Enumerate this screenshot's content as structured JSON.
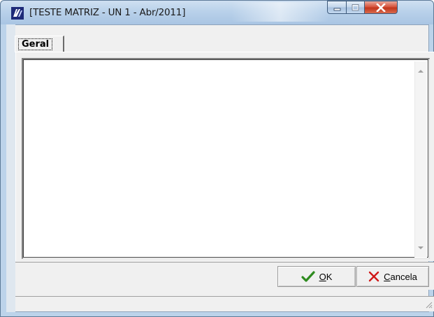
{
  "window": {
    "title": "[TESTE MATRIZ - UN 1 - Abr/2011]",
    "icon": "app-logo-icon"
  },
  "caption_buttons": {
    "minimize_icon": "minimize-icon",
    "maximize_icon": "maximize-icon",
    "close_icon": "close-icon"
  },
  "tabs": [
    {
      "label": "Geral",
      "selected": true
    }
  ],
  "memo": {
    "value": ""
  },
  "buttons": {
    "ok_label": "OK",
    "ok_icon": "checkmark-icon",
    "cancel_label": "Cancela",
    "cancel_icon": "x-mark-icon"
  },
  "status": {
    "text": ""
  },
  "colors": {
    "titlebar": "#b9d1ea",
    "face": "#f0f0f0",
    "close_button": "#c2361c",
    "ok_check": "#2e8b1f",
    "cancel_x": "#d01818"
  }
}
